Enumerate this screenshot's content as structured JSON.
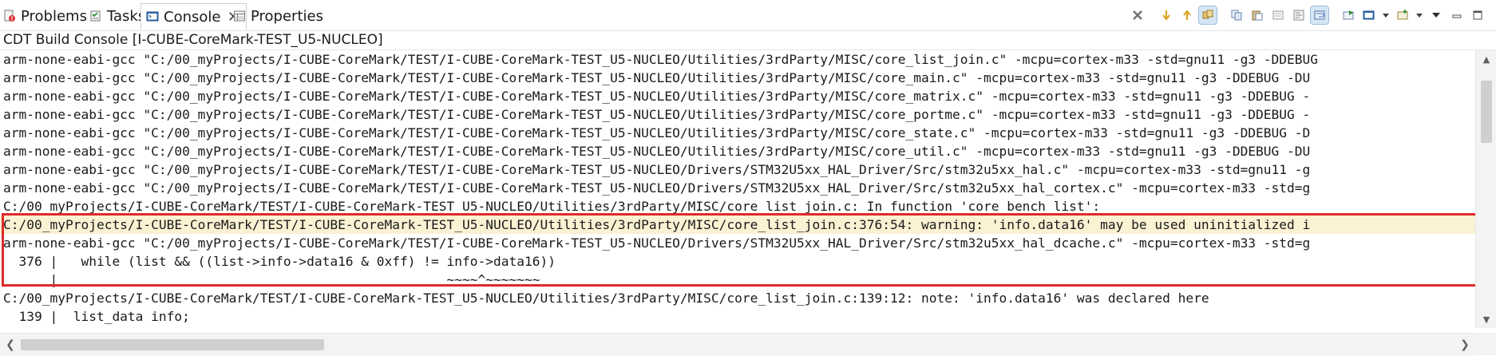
{
  "tabs": [
    {
      "label": "Problems",
      "icon": "problems-icon"
    },
    {
      "label": "Tasks",
      "icon": "tasks-icon"
    },
    {
      "label": "Console",
      "icon": "console-icon",
      "active": true,
      "close": "✕"
    },
    {
      "label": "Properties",
      "icon": "properties-icon"
    }
  ],
  "toolbar": {
    "icons": [
      "remove-all-terminated-icon",
      "next-annotation-icon",
      "previous-annotation-icon",
      "link-icon",
      "copy-icon",
      "paste-icon",
      "clear-console-icon",
      "scroll-lock-icon",
      "word-wrap-icon",
      "pin-console-icon",
      "display-selected-console-icon",
      "display-selected-dropdown-icon",
      "open-console-icon",
      "open-console-dropdown-icon",
      "view-menu-icon",
      "minimize-icon",
      "maximize-icon"
    ]
  },
  "console": {
    "title": "CDT Build Console [I-CUBE-CoreMark-TEST_U5-NUCLEO]",
    "lines": [
      "arm-none-eabi-gcc \"C:/00_myProjects/I-CUBE-CoreMark/TEST/I-CUBE-CoreMark-TEST_U5-NUCLEO/Utilities/3rdParty/MISC/core_list_join.c\" -mcpu=cortex-m33 -std=gnu11 -g3 -DDEBUG",
      "arm-none-eabi-gcc \"C:/00_myProjects/I-CUBE-CoreMark/TEST/I-CUBE-CoreMark-TEST_U5-NUCLEO/Utilities/3rdParty/MISC/core_main.c\" -mcpu=cortex-m33 -std=gnu11 -g3 -DDEBUG -DU",
      "arm-none-eabi-gcc \"C:/00_myProjects/I-CUBE-CoreMark/TEST/I-CUBE-CoreMark-TEST_U5-NUCLEO/Utilities/3rdParty/MISC/core_matrix.c\" -mcpu=cortex-m33 -std=gnu11 -g3 -DDEBUG -",
      "arm-none-eabi-gcc \"C:/00_myProjects/I-CUBE-CoreMark/TEST/I-CUBE-CoreMark-TEST_U5-NUCLEO/Utilities/3rdParty/MISC/core_portme.c\" -mcpu=cortex-m33 -std=gnu11 -g3 -DDEBUG -",
      "arm-none-eabi-gcc \"C:/00_myProjects/I-CUBE-CoreMark/TEST/I-CUBE-CoreMark-TEST_U5-NUCLEO/Utilities/3rdParty/MISC/core_state.c\" -mcpu=cortex-m33 -std=gnu11 -g3 -DDEBUG -D",
      "arm-none-eabi-gcc \"C:/00_myProjects/I-CUBE-CoreMark/TEST/I-CUBE-CoreMark-TEST_U5-NUCLEO/Utilities/3rdParty/MISC/core_util.c\" -mcpu=cortex-m33 -std=gnu11 -g3 -DDEBUG -DU",
      "arm-none-eabi-gcc \"C:/00_myProjects/I-CUBE-CoreMark/TEST/I-CUBE-CoreMark-TEST_U5-NUCLEO/Drivers/STM32U5xx_HAL_Driver/Src/stm32u5xx_hal.c\" -mcpu=cortex-m33 -std=gnu11 -g",
      "arm-none-eabi-gcc \"C:/00_myProjects/I-CUBE-CoreMark/TEST/I-CUBE-CoreMark-TEST_U5-NUCLEO/Drivers/STM32U5xx_HAL_Driver/Src/stm32u5xx_hal_cortex.c\" -mcpu=cortex-m33 -std=g",
      "C:/00_myProjects/I-CUBE-CoreMark/TEST/I-CUBE-CoreMark-TEST_U5-NUCLEO/Utilities/3rdParty/MISC/core_list_join.c: In function 'core_bench_list':",
      "C:/00_myProjects/I-CUBE-CoreMark/TEST/I-CUBE-CoreMark-TEST_U5-NUCLEO/Utilities/3rdParty/MISC/core_list_join.c:376:54: warning: 'info.data16' may be used uninitialized i",
      "arm-none-eabi-gcc \"C:/00_myProjects/I-CUBE-CoreMark/TEST/I-CUBE-CoreMark-TEST_U5-NUCLEO/Drivers/STM32U5xx_HAL_Driver/Src/stm32u5xx_hal_dcache.c\" -mcpu=cortex-m33 -std=g",
      "  376 |   while (list && ((list->info->data16 & 0xff) != info->data16))",
      "      |                                                  ~~~~^~~~~~~~",
      "C:/00_myProjects/I-CUBE-CoreMark/TEST/I-CUBE-CoreMark-TEST_U5-NUCLEO/Utilities/3rdParty/MISC/core_list_join.c:139:12: note: 'info.data16' was declared here",
      "  139 |  list_data info;",
      "      |            ^"
    ],
    "highlight_line": 9
  },
  "scrollbars": {
    "vertical_up": "▲",
    "vertical_down": "▼",
    "horizontal_left": "❮",
    "horizontal_right": "❯"
  },
  "colors": {
    "highlight_bg": "#fbf1d3",
    "selection_box": "#e02a2a",
    "active_tab_icon": "#2f6fb8"
  }
}
